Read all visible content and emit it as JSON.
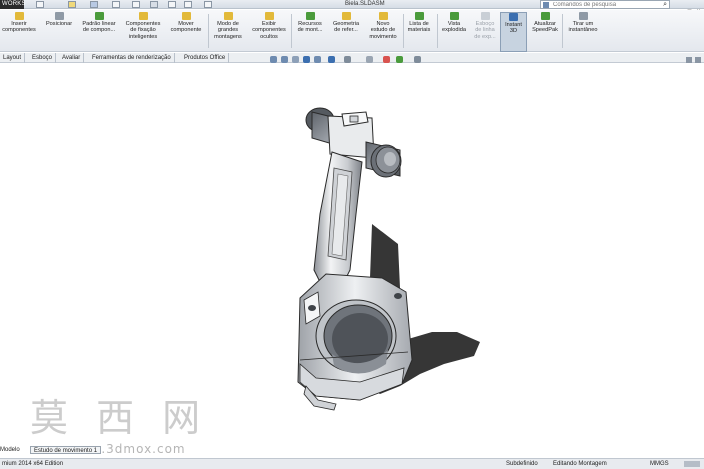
{
  "app": {
    "logo": "WORKS",
    "document_title": "Biela.SLDASM"
  },
  "search": {
    "placeholder": "Comandos de pesquisa"
  },
  "window_controls": [
    "–",
    "□",
    "×"
  ],
  "commands": [
    {
      "label": "Inserir\ncomponentes",
      "icon": "insert-component-icon"
    },
    {
      "label": "Posicionar",
      "icon": "mate-icon"
    },
    {
      "label": "Padrão linear\nde compon...",
      "icon": "linear-pattern-icon"
    },
    {
      "label": "Componentes\nde fixação\ninteligentes",
      "icon": "smart-fasteners-icon"
    },
    {
      "label": "Mover\ncomponente",
      "icon": "move-component-icon"
    },
    {
      "label": "Modo de\ngrandes\nmontagens",
      "icon": "large-assembly-icon"
    },
    {
      "label": "Exibir\ncomponentes\nocultos",
      "icon": "show-hidden-icon"
    },
    {
      "label": "Recursos\nde mont...",
      "icon": "assembly-features-icon"
    },
    {
      "label": "Geometria\nde refer...",
      "icon": "reference-geometry-icon"
    },
    {
      "label": "Novo\nestudo de\nmovimento",
      "icon": "motion-study-icon"
    },
    {
      "label": "Lista de\nmateriais",
      "icon": "bill-of-materials-icon"
    },
    {
      "label": "Vista\nexplodida",
      "icon": "exploded-view-icon"
    },
    {
      "label": "Esboço\nde linha\nde exp...",
      "icon": "explode-line-icon"
    },
    {
      "label": "Instant\n3D",
      "icon": "instant3d-icon"
    },
    {
      "label": "Atualizar\nSpeedPak",
      "icon": "speedpak-icon"
    },
    {
      "label": "Tirar um\ninstantâneo",
      "icon": "snapshot-icon"
    }
  ],
  "tabs": [
    "Layout",
    "Esboço",
    "Avaliar",
    "Ferramentas de renderização",
    "Produtos Office"
  ],
  "watermark": {
    "chars": "莫 西 网",
    "url": "www.3dmox.com"
  },
  "model_tabs": {
    "label": "Modelo",
    "active": "Estudo de movimento 1"
  },
  "status": {
    "edition": "mium 2014 x64 Edition",
    "definition": "Subdefinido",
    "mode": "Editando Montagem",
    "units": "MMGS"
  },
  "colors": {
    "accent": "#2f6db5",
    "icon_yellow": "#e2b93a",
    "icon_green": "#4a9b3c",
    "icon_blue": "#3c6fb0",
    "part_gray": "#c9ccd0",
    "shadow": "#353535"
  }
}
